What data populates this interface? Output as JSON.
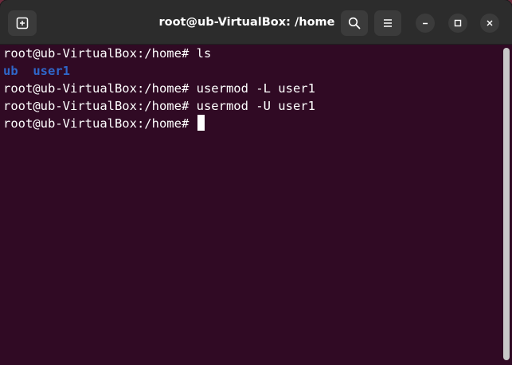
{
  "window": {
    "title": "root@ub-VirtualBox: /home"
  },
  "icons": {
    "new_tab": "new-tab-icon",
    "search": "search-icon",
    "menu": "hamburger-menu-icon",
    "minimize": "minimize-icon",
    "maximize": "maximize-icon",
    "close": "close-icon"
  },
  "terminal": {
    "prompt": "root@ub-VirtualBox:/home#",
    "lines": [
      {
        "prompt": "root@ub-VirtualBox:/home#",
        "command": " ls"
      },
      {
        "output_dirs": [
          "ub",
          "user1"
        ]
      },
      {
        "prompt": "root@ub-VirtualBox:/home#",
        "command": " usermod -L user1"
      },
      {
        "prompt": "root@ub-VirtualBox:/home#",
        "command": " usermod -U user1"
      },
      {
        "prompt": "root@ub-VirtualBox:/home#",
        "command": " "
      }
    ]
  },
  "colors": {
    "terminal_bg": "#300a24",
    "titlebar_bg": "#2c2c2c",
    "directory_text": "#2f66c9",
    "text": "#ffffff"
  }
}
